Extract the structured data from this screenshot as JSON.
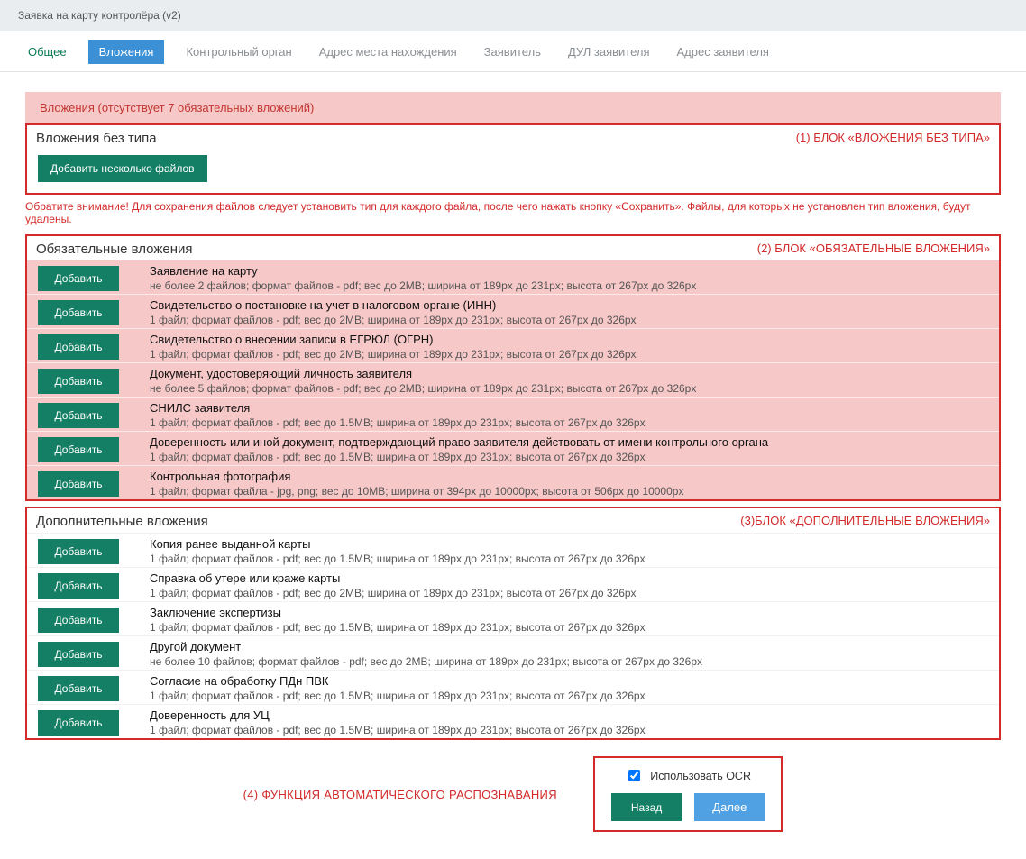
{
  "page_title": "Заявка на карту контролёра (v2)",
  "tabs": [
    "Общее",
    "Вложения",
    "Контрольный орган",
    "Адрес места нахождения",
    "Заявитель",
    "ДУЛ заявителя",
    "Адрес заявителя"
  ],
  "active_tab_index": 1,
  "alert_text": "Вложения (отсутствует 7 обязательных вложений)",
  "annotations": {
    "untyped": "(1) БЛОК «ВЛОЖЕНИЯ БЕЗ ТИПА»",
    "required": "(2) БЛОК «ОБЯЗАТЕЛЬНЫЕ ВЛОЖЕНИЯ»",
    "optional": "(3)БЛОК «ДОПОЛНИТЕЛЬНЫЕ ВЛОЖЕНИЯ»",
    "ocr": "(4) ФУНКЦИЯ АВТОМАТИЧЕСКОГО РАСПОЗНАВАНИЯ"
  },
  "untyped": {
    "heading": "Вложения без типа",
    "add_many_label": "Добавить несколько файлов"
  },
  "warning_note": "Обратите внимание! Для сохранения файлов следует установить тип для каждого файла, после чего нажать кнопку «Сохранить». Файлы, для которых не установлен тип вложения, будут удалены.",
  "add_label": "Добавить",
  "required": {
    "heading": "Обязательные вложения",
    "items": [
      {
        "title": "Заявление на карту",
        "desc": "не более 2 файлов; формат файлов - pdf; вес до 2MB; ширина от 189px до 231px; высота от 267px до 326px"
      },
      {
        "title": "Свидетельство о постановке на учет в налоговом органе (ИНН)",
        "desc": "1 файл; формат файлов - pdf; вес до 2MB; ширина от 189px до 231px; высота от 267px до 326px"
      },
      {
        "title": "Свидетельство о внесении записи в ЕГРЮЛ (ОГРН)",
        "desc": "1 файл; формат файлов - pdf; вес до 2MB; ширина от 189px до 231px; высота от 267px до 326px"
      },
      {
        "title": "Документ, удостоверяющий личность заявителя",
        "desc": "не более 5 файлов; формат файлов - pdf; вес до 2MB; ширина от 189px до 231px; высота от 267px до 326px"
      },
      {
        "title": "СНИЛС заявителя",
        "desc": "1 файл; формат файлов - pdf; вес до 1.5MB; ширина от 189px до 231px; высота от 267px до 326px"
      },
      {
        "title": "Доверенность или иной документ, подтверждающий право заявителя действовать от имени контрольного органа",
        "desc": "1 файл; формат файлов - pdf; вес до 1.5MB; ширина от 189px до 231px; высота от 267px до 326px"
      },
      {
        "title": "Контрольная фотография",
        "desc": "1 файл; формат файла - jpg, png; вес до 10MB; ширина от 394px до 10000px; высота от 506px до 10000px"
      }
    ]
  },
  "optional": {
    "heading": "Дополнительные вложения",
    "items": [
      {
        "title": "Копия ранее выданной карты",
        "desc": "1 файл; формат файлов - pdf; вес до 1.5MB; ширина от 189px до 231px; высота от 267px до 326px"
      },
      {
        "title": "Справка об утере или краже карты",
        "desc": "1 файл; формат файлов - pdf; вес до 2MB; ширина от 189px до 231px; высота от 267px до 326px"
      },
      {
        "title": "Заключение экспертизы",
        "desc": "1 файл; формат файлов - pdf; вес до 1.5MB; ширина от 189px до 231px; высота от 267px до 326px"
      },
      {
        "title": "Другой документ",
        "desc": "не более 10 файлов; формат файлов - pdf; вес до 2MB; ширина от 189px до 231px; высота от 267px до 326px"
      },
      {
        "title": "Согласие на обработку ПДн ПВК",
        "desc": "1 файл; формат файлов - pdf; вес до 1.5MB; ширина от 189px до 231px; высота от 267px до 326px"
      },
      {
        "title": "Доверенность для УЦ",
        "desc": "1 файл; формат файлов - pdf; вес до 1.5MB; ширина от 189px до 231px; высота от 267px до 326px"
      }
    ]
  },
  "ocr": {
    "checkbox_label": "Использовать OCR",
    "checked": true
  },
  "nav": {
    "back": "Назад",
    "next": "Далее"
  }
}
